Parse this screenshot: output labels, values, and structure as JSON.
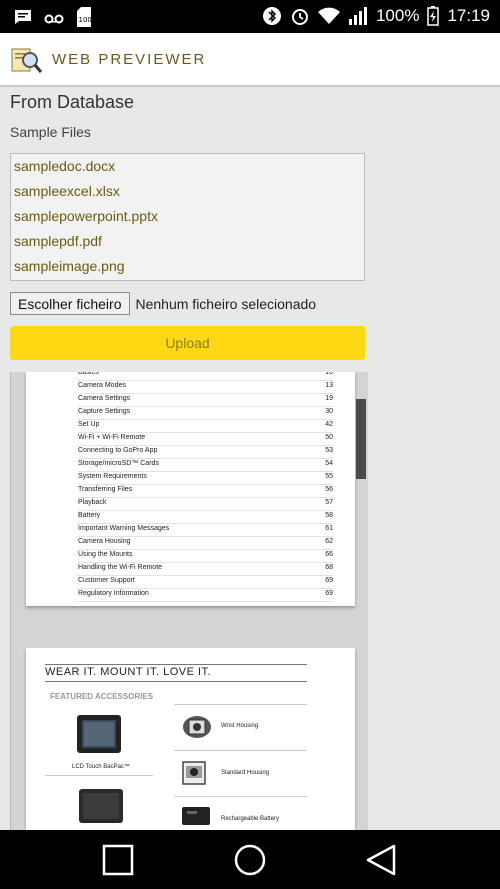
{
  "status": {
    "battery_text": "100%",
    "time": "17:19"
  },
  "appbar": {
    "title": "WEB PREVIEWER"
  },
  "main": {
    "heading": "From Database",
    "subheading": "Sample Files",
    "files": [
      "sampledoc.docx",
      "sampleexcel.xlsx",
      "samplepowerpoint.pptx",
      "samplepdf.pdf",
      "sampleimage.png"
    ],
    "file_button_label": "Escolher ficheiro",
    "file_status": "Nenhum ficheiro selecionado",
    "upload_label": "Upload"
  },
  "viewer": {
    "toc": [
      {
        "title": "Basics",
        "page": "10"
      },
      {
        "title": "Camera Modes",
        "page": "13"
      },
      {
        "title": "Camera Settings",
        "page": "19"
      },
      {
        "title": "Capture Settings",
        "page": "30"
      },
      {
        "title": "Set Up",
        "page": "42"
      },
      {
        "title": "Wi-Fi + Wi-Fi Remote",
        "page": "50"
      },
      {
        "title": "Connecting to GoPro App",
        "page": "53"
      },
      {
        "title": "Storage/microSD™ Cards",
        "page": "54"
      },
      {
        "title": "System Requirements",
        "page": "55"
      },
      {
        "title": "Transferring Files",
        "page": "56"
      },
      {
        "title": "Playback",
        "page": "57"
      },
      {
        "title": "Battery",
        "page": "58"
      },
      {
        "title": "Important Warning Messages",
        "page": "61"
      },
      {
        "title": "Camera Housing",
        "page": "62"
      },
      {
        "title": "Using the Mounts",
        "page": "66"
      },
      {
        "title": "Handling the Wi-Fi Remote",
        "page": "68"
      },
      {
        "title": "Customer Support",
        "page": "69"
      },
      {
        "title": "Regulatory Information",
        "page": "69"
      }
    ],
    "page2_title": "WEAR IT. MOUNT IT. LOVE IT.",
    "featured_label": "FEATURED ACCESSORIES",
    "accessories": {
      "lcd": "LCD Touch BacPac™",
      "wrist": "Wrist Housing",
      "standard": "Standard Housing",
      "battery": "Rechargeable Battery"
    }
  }
}
